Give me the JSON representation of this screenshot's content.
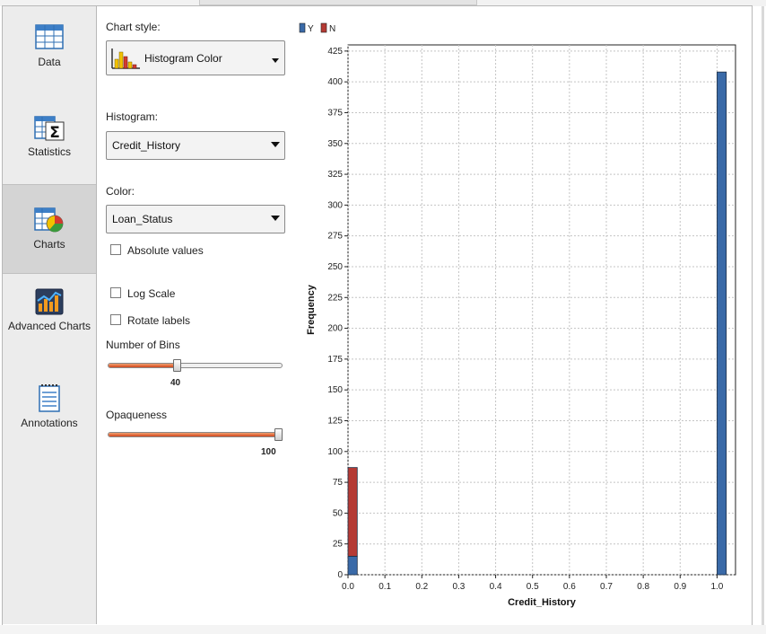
{
  "sidebar": {
    "items": [
      {
        "label": "Data",
        "icon": "table-icon"
      },
      {
        "label": "Statistics",
        "icon": "sigma-table-icon"
      },
      {
        "label": "Charts",
        "icon": "chart-pie-icon"
      },
      {
        "label": "Advanced Charts",
        "icon": "advanced-chart-icon"
      },
      {
        "label": "Annotations",
        "icon": "notepad-icon"
      }
    ],
    "active_index": 2
  },
  "controls": {
    "chart_style_label": "Chart style:",
    "chart_style_value": "Histogram Color",
    "histogram_label": "Histogram:",
    "histogram_value": "Credit_History",
    "color_label": "Color:",
    "color_value": "Loan_Status",
    "absolute_values_label": "Absolute values",
    "absolute_values_checked": false,
    "log_scale_label": "Log Scale",
    "log_scale_checked": false,
    "rotate_labels_label": "Rotate labels",
    "rotate_labels_checked": false,
    "bins_label": "Number of Bins",
    "bins_value": "40",
    "bins_fraction": 0.39,
    "opaqueness_label": "Opaqueness",
    "opaqueness_value": "100",
    "opaqueness_fraction": 1.0
  },
  "colors": {
    "series_y": "#3a6aa8",
    "series_n": "#b53a34",
    "slider_fill": "#d2461c",
    "sidebar_bg": "#ececec",
    "sidebar_active": "#d4d4d4"
  },
  "chart_data": {
    "type": "bar",
    "stacked": true,
    "xlabel": "Credit_History",
    "ylabel": "Frequency",
    "xlim": [
      0.0,
      1.05
    ],
    "ylim": [
      0,
      430
    ],
    "xticks": [
      "0.0",
      "0.1",
      "0.2",
      "0.3",
      "0.4",
      "0.5",
      "0.6",
      "0.7",
      "0.8",
      "0.9",
      "1.0"
    ],
    "yticks": [
      "0",
      "25",
      "50",
      "75",
      "100",
      "125",
      "150",
      "175",
      "200",
      "225",
      "250",
      "275",
      "300",
      "325",
      "350",
      "375",
      "400",
      "425"
    ],
    "grid": true,
    "legend_position": "top-left",
    "bin_width": 0.025,
    "bins": [
      0.0,
      1.0
    ],
    "series": [
      {
        "name": "Y",
        "color": "#3a6aa8",
        "values": [
          15,
          408
        ]
      },
      {
        "name": "N",
        "color": "#b53a34",
        "values": [
          72,
          0
        ]
      }
    ]
  }
}
